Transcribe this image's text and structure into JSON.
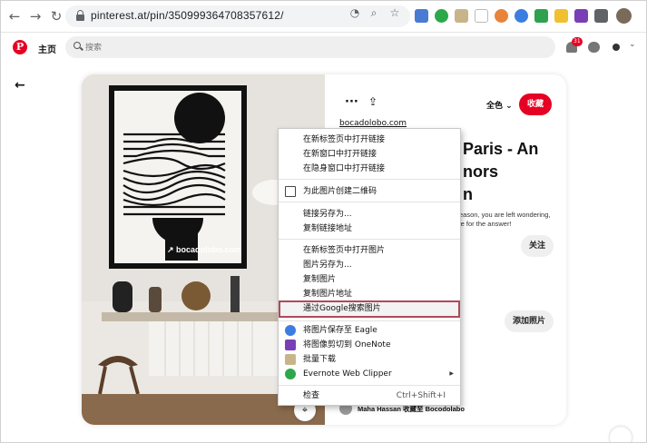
{
  "browser": {
    "url": "pinterest.at/pin/350999364708357612/",
    "colors": {
      "toolbar_bg": "#ffffff",
      "omnibox_bg": "#f1f3f4"
    }
  },
  "pinterest": {
    "home_label": "主页",
    "search_placeholder": "搜索",
    "notification_count": "31",
    "colors": {
      "brand": "#e60023"
    }
  },
  "pin": {
    "image_watermark": "bocadolobo.com",
    "board_label": "全色",
    "save_label": "收藏",
    "source_link": "bocadolobo.com",
    "title_fragments": [
      "Paris - An",
      "nors",
      "n"
    ],
    "description_fragments": [
      "eason, you are left wondering,",
      "le for the answer!"
    ],
    "follow_label": "关注",
    "add_photo_label": "添加照片",
    "author": "Maha Hassan 收藏至 Bocodolabo"
  },
  "context_menu": {
    "items": [
      "在新标签页中打开链接",
      "在新窗口中打开链接",
      "在隐身窗口中打开链接",
      "为此图片创建二维码",
      "链接另存为...",
      "复制链接地址",
      "在新标签页中打开图片",
      "图片另存为...",
      "复制图片",
      "复制图片地址",
      "通过Google搜索图片",
      "将图片保存至 Eagle",
      "将图像剪切到 OneNote",
      "批量下载",
      "Evernote Web Clipper",
      "检查"
    ],
    "inspect_shortcut": "Ctrl+Shift+I",
    "highlighted_item": "通过Google搜索图片"
  }
}
